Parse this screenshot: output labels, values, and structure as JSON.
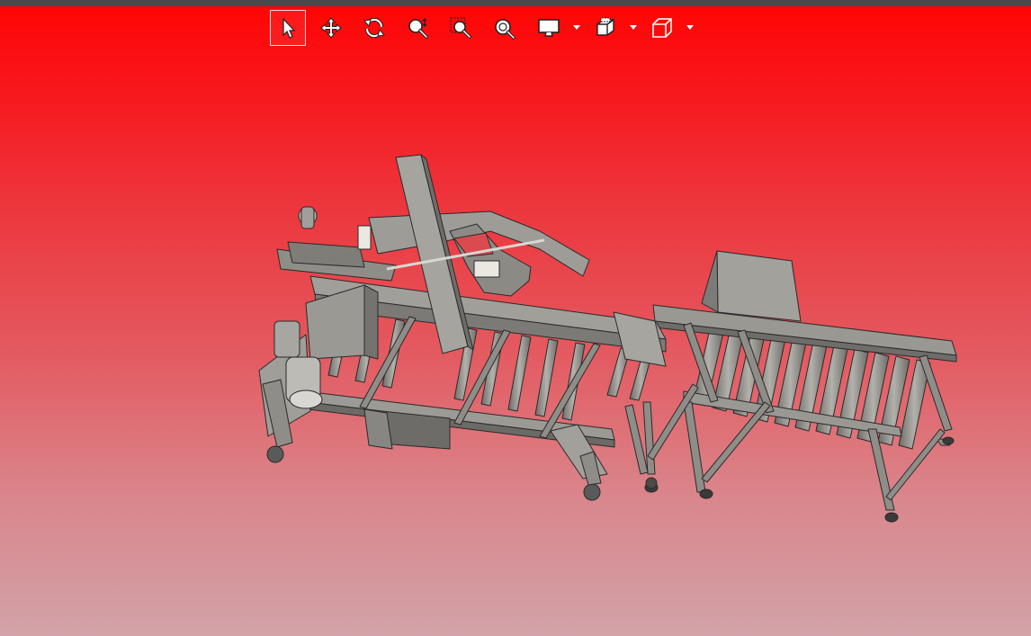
{
  "toolbar": {
    "items": [
      {
        "icon": "select-arrow-icon",
        "active": true
      },
      {
        "icon": "pan-move-icon",
        "active": false
      },
      {
        "icon": "rotate-icon",
        "active": false
      },
      {
        "icon": "zoom-icon",
        "active": false
      },
      {
        "icon": "zoom-window-icon",
        "active": false
      },
      {
        "icon": "zoom-fit-icon",
        "active": false
      },
      {
        "icon": "display-mode-icon",
        "dropdown": true
      },
      {
        "icon": "section-view-icon",
        "dropdown": true
      },
      {
        "icon": "standard-views-icon",
        "dropdown": true
      }
    ]
  },
  "viewport": {
    "background_top": "#ff0505",
    "background_bottom": "#d2a3a8",
    "model_color": "#8f8d88",
    "model": "case-erector-conveyor-assembly"
  }
}
